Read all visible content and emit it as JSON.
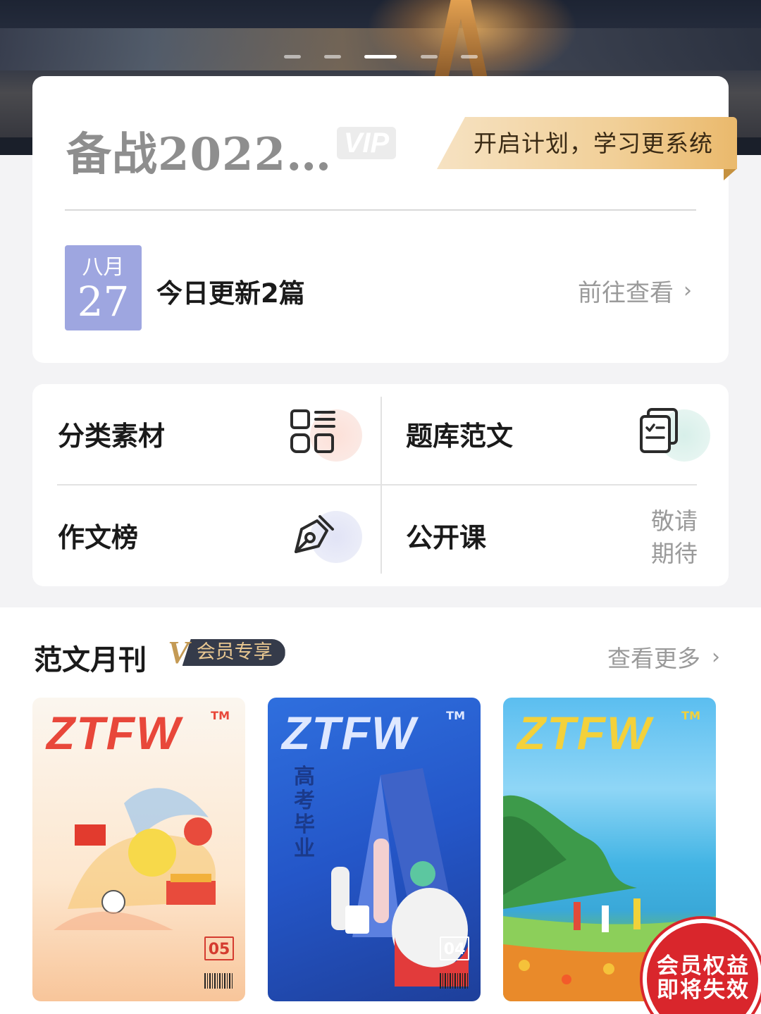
{
  "banner": {
    "indicators": 5,
    "active_index": 2
  },
  "plan": {
    "title": "备战2022…",
    "vip_badge": "VIP",
    "cta": "开启计划，学习更系统",
    "date_month": "八月",
    "date_day": "27",
    "update_text": "今日更新2篇",
    "goto_label": "前往查看",
    "chevron": "›"
  },
  "features": {
    "items": [
      {
        "label": "分类素材",
        "icon": "category-icon"
      },
      {
        "label": "题库范文",
        "icon": "document-list-icon"
      },
      {
        "label": "作文榜",
        "icon": "pen-nib-icon"
      },
      {
        "label": "公开课",
        "icon": ""
      }
    ],
    "coming_soon_line1": "敬请",
    "coming_soon_line2": "期待"
  },
  "monthly": {
    "title": "范文月刊",
    "member_v": "V",
    "member_tag": "会员专享",
    "more_label": "查看更多",
    "chevron": "›",
    "covers": [
      {
        "logo": "ZTFW",
        "tm": "TM",
        "issue": "05"
      },
      {
        "logo": "ZTFW",
        "tm": "TM",
        "issue": "04",
        "vertical_text": "高考毕业"
      },
      {
        "logo": "ZTFW",
        "tm": "TM",
        "issue": ""
      }
    ]
  },
  "stamp": {
    "line1": "会员权益",
    "line2": "即将失效"
  },
  "colors": {
    "date_tile": "#9ea6e0",
    "ribbon_gold": "#f1cf97",
    "member_pill": "#353b4a",
    "stamp_red": "#d9262c"
  }
}
